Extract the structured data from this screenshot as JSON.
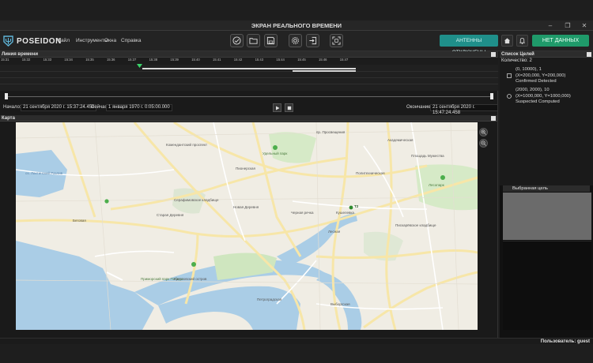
{
  "window": {
    "title": "ЭКРАН РЕАЛЬНОГО ВРЕМЕНИ"
  },
  "app": {
    "name": "POSEIDON"
  },
  "menu": [
    {
      "label": "Файл"
    },
    {
      "label": "Инструменты"
    },
    {
      "label": "Окна"
    },
    {
      "label": "Справка"
    }
  ],
  "toolbar": {
    "antennas_label": "АНТЕННЫ ОТКЛЮЧЕНЫ",
    "nodata_label": "НЕТ ДАННЫХ"
  },
  "timeline": {
    "header": "Линия времени",
    "ticks": [
      "15:31",
      "15:32",
      "15:33",
      "15:34",
      "15:35",
      "15:36",
      "15:37",
      "15:38",
      "15:39",
      "15:40",
      "15:41",
      "15:42",
      "15:43",
      "15:44",
      "15:45",
      "15:46",
      "15:47"
    ],
    "start_label": "Начало:",
    "start_value": "21 сентября 2020 г. 15:37:24.458",
    "now_label": "Сейчас:",
    "now_value": "1 января 1970 г. 0:05:00.000",
    "end_label": "Окончание:",
    "end_value": "21 сентября 2020 г. 15:47:24.458"
  },
  "map": {
    "header": "Карта",
    "labels": {
      "district_north": "Комендантский проспект",
      "park_udelny": "Удельный парк",
      "pionerskaya": "Пионерская",
      "lesnoy_park": "Лесопарк",
      "lake": "оз. Лахтинский Разлив",
      "staraya_derevnya": "Старая Деревня",
      "begovaya": "Беговая",
      "serafimovskoe": "Серафимовское кладбище",
      "chernaya_rechka": "Черная речка",
      "novaya_derevnya": "Новая Деревня",
      "lesnaya": "Лесная",
      "primorsky": "Приморский парк Победы",
      "krestovsky": "Крестовский остров",
      "petrogradskaya": "Петроградская",
      "vyborgskaya": "Выборгская",
      "ploshchad_muzhestva": "Площадь Мужества",
      "politeh": "Политехническая",
      "akademicheskaya": "Академическая",
      "piskarevskoe": "Пискарёвское кладбище",
      "kushelevka": "Кушелевка",
      "prospekt_prosv": "пр. Просвещения"
    },
    "markers": [
      {
        "label": "T2"
      }
    ]
  },
  "targets": {
    "header": "Список Целей",
    "count_label": "Количество: 2",
    "items": [
      {
        "line1": "(0, 10000), 1",
        "line2": "(X=200,000, Y=200,000)",
        "line3": "Confirmed Detected"
      },
      {
        "line1": "(2000, 2000), 10",
        "line2": "(X=1000,000, Y=1000,000)",
        "line3": "Suspected Computed"
      }
    ]
  },
  "selected": {
    "header": "Выбранная цель"
  },
  "status": {
    "user": "Пользователь: guest"
  },
  "colors": {
    "accent_teal": "#1f8f8a",
    "accent_green": "#1f9a6a"
  }
}
